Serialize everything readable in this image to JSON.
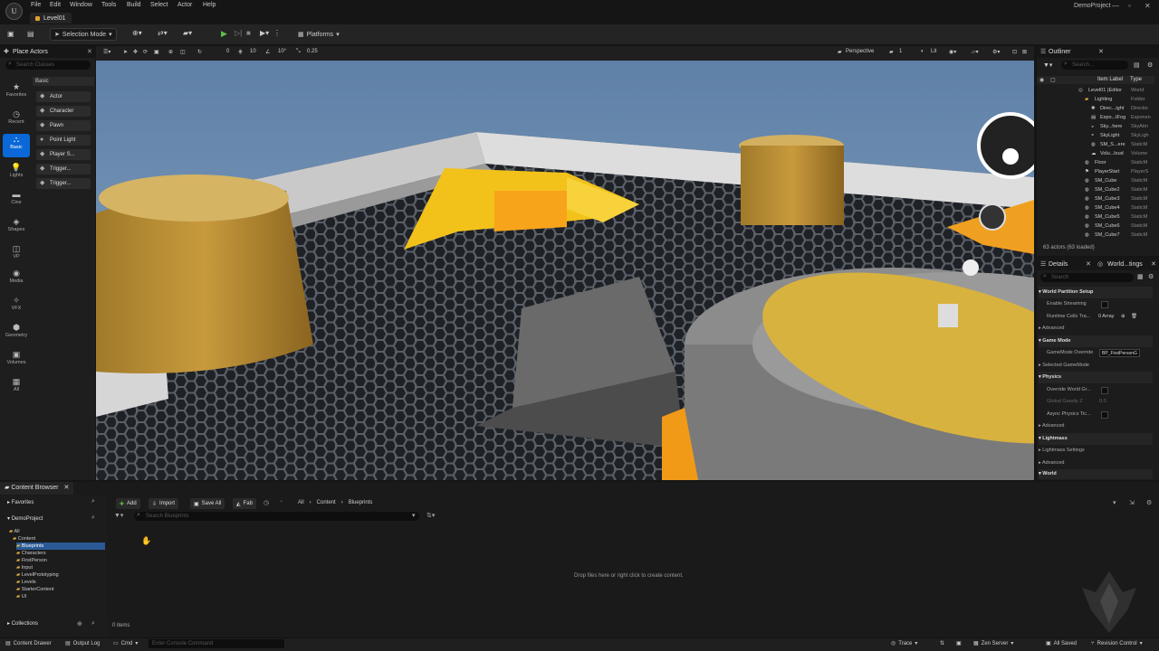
{
  "menu": {
    "items": [
      "File",
      "Edit",
      "Window",
      "Tools",
      "Build",
      "Select",
      "Actor",
      "Help"
    ],
    "project_name": "DemoProject",
    "level_tab": "Level01",
    "logo": "U"
  },
  "toolbar": {
    "selection_mode": "Selection Mode",
    "platforms": "Platforms"
  },
  "viewport": {
    "perspective": "Perspective",
    "lit": "Lit",
    "grid_snap": "10",
    "rot_snap": "10°",
    "scale_snap": "0.25",
    "cam_speed": "1",
    "snap_zero": "0"
  },
  "place_actors": {
    "title": "Place Actors",
    "search_placeholder": "Search Classes",
    "categories": [
      "Favorites",
      "Recent",
      "Basic",
      "Lights",
      "Cine",
      "Shapes",
      "VP",
      "Media",
      "VFX",
      "Geometry",
      "Volumes",
      "All"
    ],
    "section": "Basic",
    "actors": [
      "Actor",
      "Character",
      "Pawn",
      "Point Light",
      "Player S...",
      "Trigger...",
      "Trigger..."
    ]
  },
  "outliner": {
    "title": "Outliner",
    "search_placeholder": "Search...",
    "col_label": "Item Label",
    "col_type": "Type",
    "rows": [
      {
        "label": "Level01 (Editor",
        "type": "World"
      },
      {
        "label": "Lighting",
        "type": "Folder"
      },
      {
        "label": "Direc...ight",
        "type": "Directio"
      },
      {
        "label": "Expo...tFog",
        "type": "Exponen"
      },
      {
        "label": "Sky...here",
        "type": "SkyAtm"
      },
      {
        "label": "SkyLight",
        "type": "SkyLigh"
      },
      {
        "label": "SM_S...ere",
        "type": "StaticM"
      },
      {
        "label": "Volu...loud",
        "type": "Volume"
      },
      {
        "label": "Floor",
        "type": "StaticM"
      },
      {
        "label": "PlayerStart",
        "type": "PlayerS"
      },
      {
        "label": "SM_Cube",
        "type": "StaticM"
      },
      {
        "label": "SM_Cube2",
        "type": "StaticM"
      },
      {
        "label": "SM_Cube3",
        "type": "StaticM"
      },
      {
        "label": "SM_Cube4",
        "type": "StaticM"
      },
      {
        "label": "SM_Cube5",
        "type": "StaticM"
      },
      {
        "label": "SM_Cube6",
        "type": "StaticM"
      },
      {
        "label": "SM_Cube7",
        "type": "StaticM"
      }
    ],
    "count": "63 actors (63 loaded)"
  },
  "details": {
    "tab1": "Details",
    "tab2": "World...tings",
    "search_placeholder": "Search",
    "rows": [
      {
        "label": "World Partition Setup",
        "section": true
      },
      {
        "label": "Enable Streaming",
        "check": true
      },
      {
        "label": "Runtime Cells Tra...",
        "value": "0 Array"
      },
      {
        "label": "Advanced",
        "sub": true
      },
      {
        "label": "Game Mode",
        "section": true
      },
      {
        "label": "GameMode Override",
        "value": "BP_FirstPersonG"
      },
      {
        "label": "Selected GameMode",
        "sub": true
      },
      {
        "label": "Physics",
        "section": true
      },
      {
        "label": "Override World Gr...",
        "check": true
      },
      {
        "label": "Global Gravity Z",
        "value": "0.0"
      },
      {
        "label": "Async Physics Tic...",
        "check": true
      },
      {
        "label": "Advanced",
        "sub": true
      },
      {
        "label": "Lightmass",
        "section": true
      },
      {
        "label": "Lightmass Settings",
        "sub": true
      },
      {
        "label": "Advanced",
        "sub": true
      },
      {
        "label": "World",
        "section": true
      }
    ]
  },
  "content_browser": {
    "title": "Content Browser",
    "favorites": "Favorites",
    "project": "DemoProject",
    "tree": [
      "All",
      "Content",
      "Blueprints",
      "Characters",
      "FirstPerson",
      "Input",
      "LevelPrototyping",
      "Levels",
      "StarterContent",
      "UI"
    ],
    "collections": "Collections",
    "add": "Add",
    "import": "Import",
    "save_all": "Save All",
    "fab": "Fab",
    "path": [
      "All",
      "Content",
      "Blueprints"
    ],
    "search_placeholder": "Search Blueprints",
    "drop_message": "Drop files here or right click to create content.",
    "items_count": "0 items"
  },
  "statusbar": {
    "content_drawer": "Content Drawer",
    "output_log": "Output Log",
    "cmd": "Cmd",
    "console_placeholder": "Enter Console Command",
    "trace": "Trace",
    "zen": "Zen Server",
    "all_saved": "All Saved",
    "revision": "Revision Control"
  }
}
